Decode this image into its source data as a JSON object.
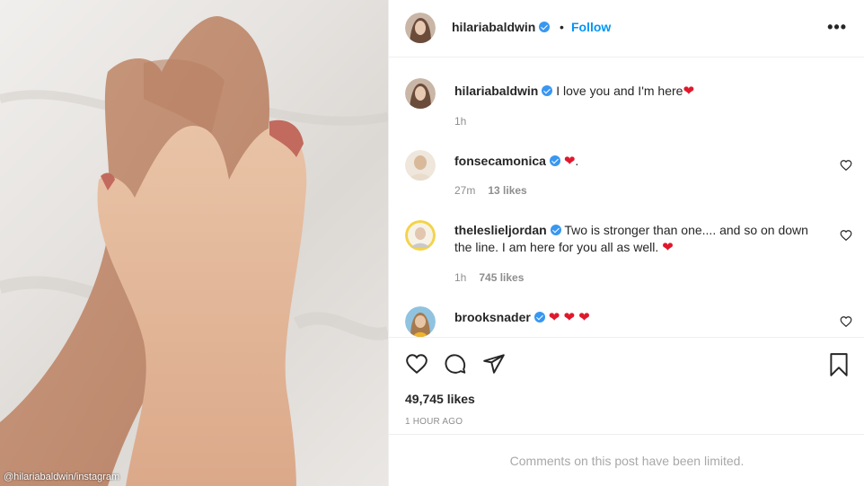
{
  "photo": {
    "credit": "@hilariabaldwin/instagram"
  },
  "header": {
    "username": "hilariabaldwin",
    "separator": "•",
    "follow_label": "Follow",
    "more_label": "•••"
  },
  "caption": {
    "username": "hilariabaldwin",
    "text": "I love you and I'm here",
    "emoji": "❤",
    "time": "1h"
  },
  "comments": [
    {
      "username": "fonsecamonica",
      "text": "",
      "emoji": "❤",
      "trailing": ".",
      "time": "27m",
      "likes": "13 likes"
    },
    {
      "username": "theleslieljordan",
      "text": "Two is stronger than one.... and so on down the line. I am here for you all as well.",
      "emoji": "❤",
      "time": "1h",
      "likes": "745 likes"
    },
    {
      "username": "brooksnader",
      "text": "",
      "emoji": "❤ ❤ ❤"
    }
  ],
  "likes_count": "49,745 likes",
  "posted": "1 HOUR AGO",
  "limited_text": "Comments on this post have been limited.",
  "colors": {
    "link": "#0095f6",
    "verified": "#3897f0",
    "heart": "#e0182d",
    "muted": "#8e8e8e"
  }
}
